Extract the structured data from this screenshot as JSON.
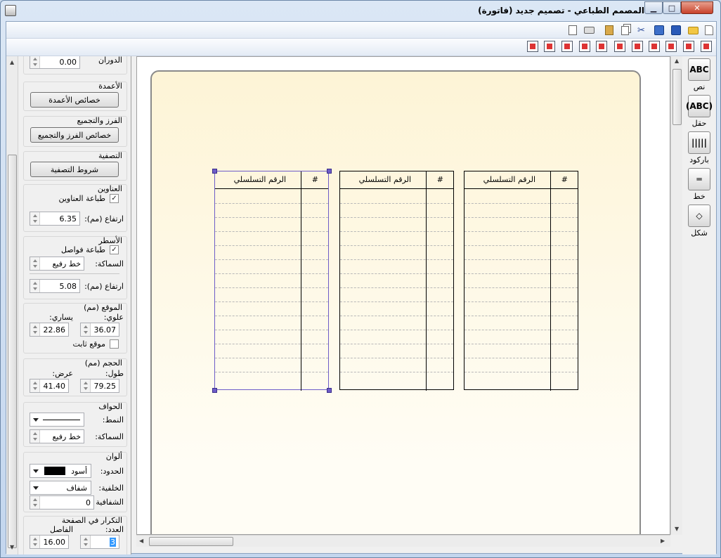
{
  "window": {
    "title": "المصمم الطباعي - تصميم جديد (فاتورة)",
    "min_label": "▁",
    "max_label": "□",
    "close_label": "✕"
  },
  "toolbar1": {
    "icons": [
      "new-icon",
      "open-icon",
      "save-icon",
      "save-as-icon",
      "cut-icon",
      "copy-icon",
      "paste-icon",
      "print-icon",
      "print-preview-icon"
    ]
  },
  "left_panel": {
    "rotation": {
      "label": "الدوران",
      "value": "0.00"
    },
    "columns": {
      "title": "الأعمدة",
      "button": "خصائص الأعمدة"
    },
    "sorting": {
      "title": "الفرز والتجميع",
      "button": "خصائص الفرز والتجميع"
    },
    "filter": {
      "title": "التصفية",
      "button": "شروط التصفية"
    },
    "headers": {
      "title": "العناوين",
      "print_label": "طباعة العناوين",
      "print_checked": true,
      "height_label": "ارتفاع (مم):",
      "height_value": "6.35"
    },
    "rows": {
      "title": "الأسطر",
      "print_sep_label": "طباعة فواصل",
      "print_sep_checked": true,
      "thickness_label": "السماكة:",
      "thickness_value": "خط رفيع",
      "height_label": "ارتفاع (مم):",
      "height_value": "5.08"
    },
    "position": {
      "title": "الموقع (مم)",
      "top_label": "علوي:",
      "top_value": "36.07",
      "left_label": "يساري:",
      "left_value": "22.86",
      "fixed_label": "موقع ثابت",
      "fixed_checked": false
    },
    "size": {
      "title": "الحجم (مم)",
      "length_label": "طول:",
      "length_value": "79.25",
      "width_label": "عرض:",
      "width_value": "41.40"
    },
    "borders": {
      "title": "الحواف",
      "style_label": "النمط:",
      "thickness_label": "السماكة:",
      "thickness_value": "خط رفيع"
    },
    "colors": {
      "title": "ألوان",
      "border_label": "الحدود:",
      "border_value": "أسود",
      "border_color": "#000000",
      "bg_label": "الخلفية:",
      "bg_value": "شفاف",
      "transparency_label": "الشفافية",
      "transparency_value": "0"
    },
    "repeat": {
      "title": "التكرار في الصفحة",
      "count_label": "العدد:",
      "count_value": "3",
      "gap_label": "الفاصل",
      "gap_value": "16.00"
    }
  },
  "right_tools": [
    {
      "name": "text-tool",
      "icon": "ABC",
      "label": "نص"
    },
    {
      "name": "field-tool",
      "icon": "(ABC)",
      "label": "حقل"
    },
    {
      "name": "barcode-tool",
      "icon": "|||||",
      "label": "باركود"
    },
    {
      "name": "line-tool",
      "icon": "═",
      "label": "خط"
    },
    {
      "name": "shape-tool",
      "icon": "◇",
      "label": "شكل"
    }
  ],
  "tables": [
    {
      "col_hash": "#",
      "col_serial": "الرقم التسلسلي"
    },
    {
      "col_hash": "#",
      "col_serial": "الرقم التسلسلي"
    },
    {
      "col_hash": "#",
      "col_serial": "الرقم التسلسلي"
    }
  ]
}
